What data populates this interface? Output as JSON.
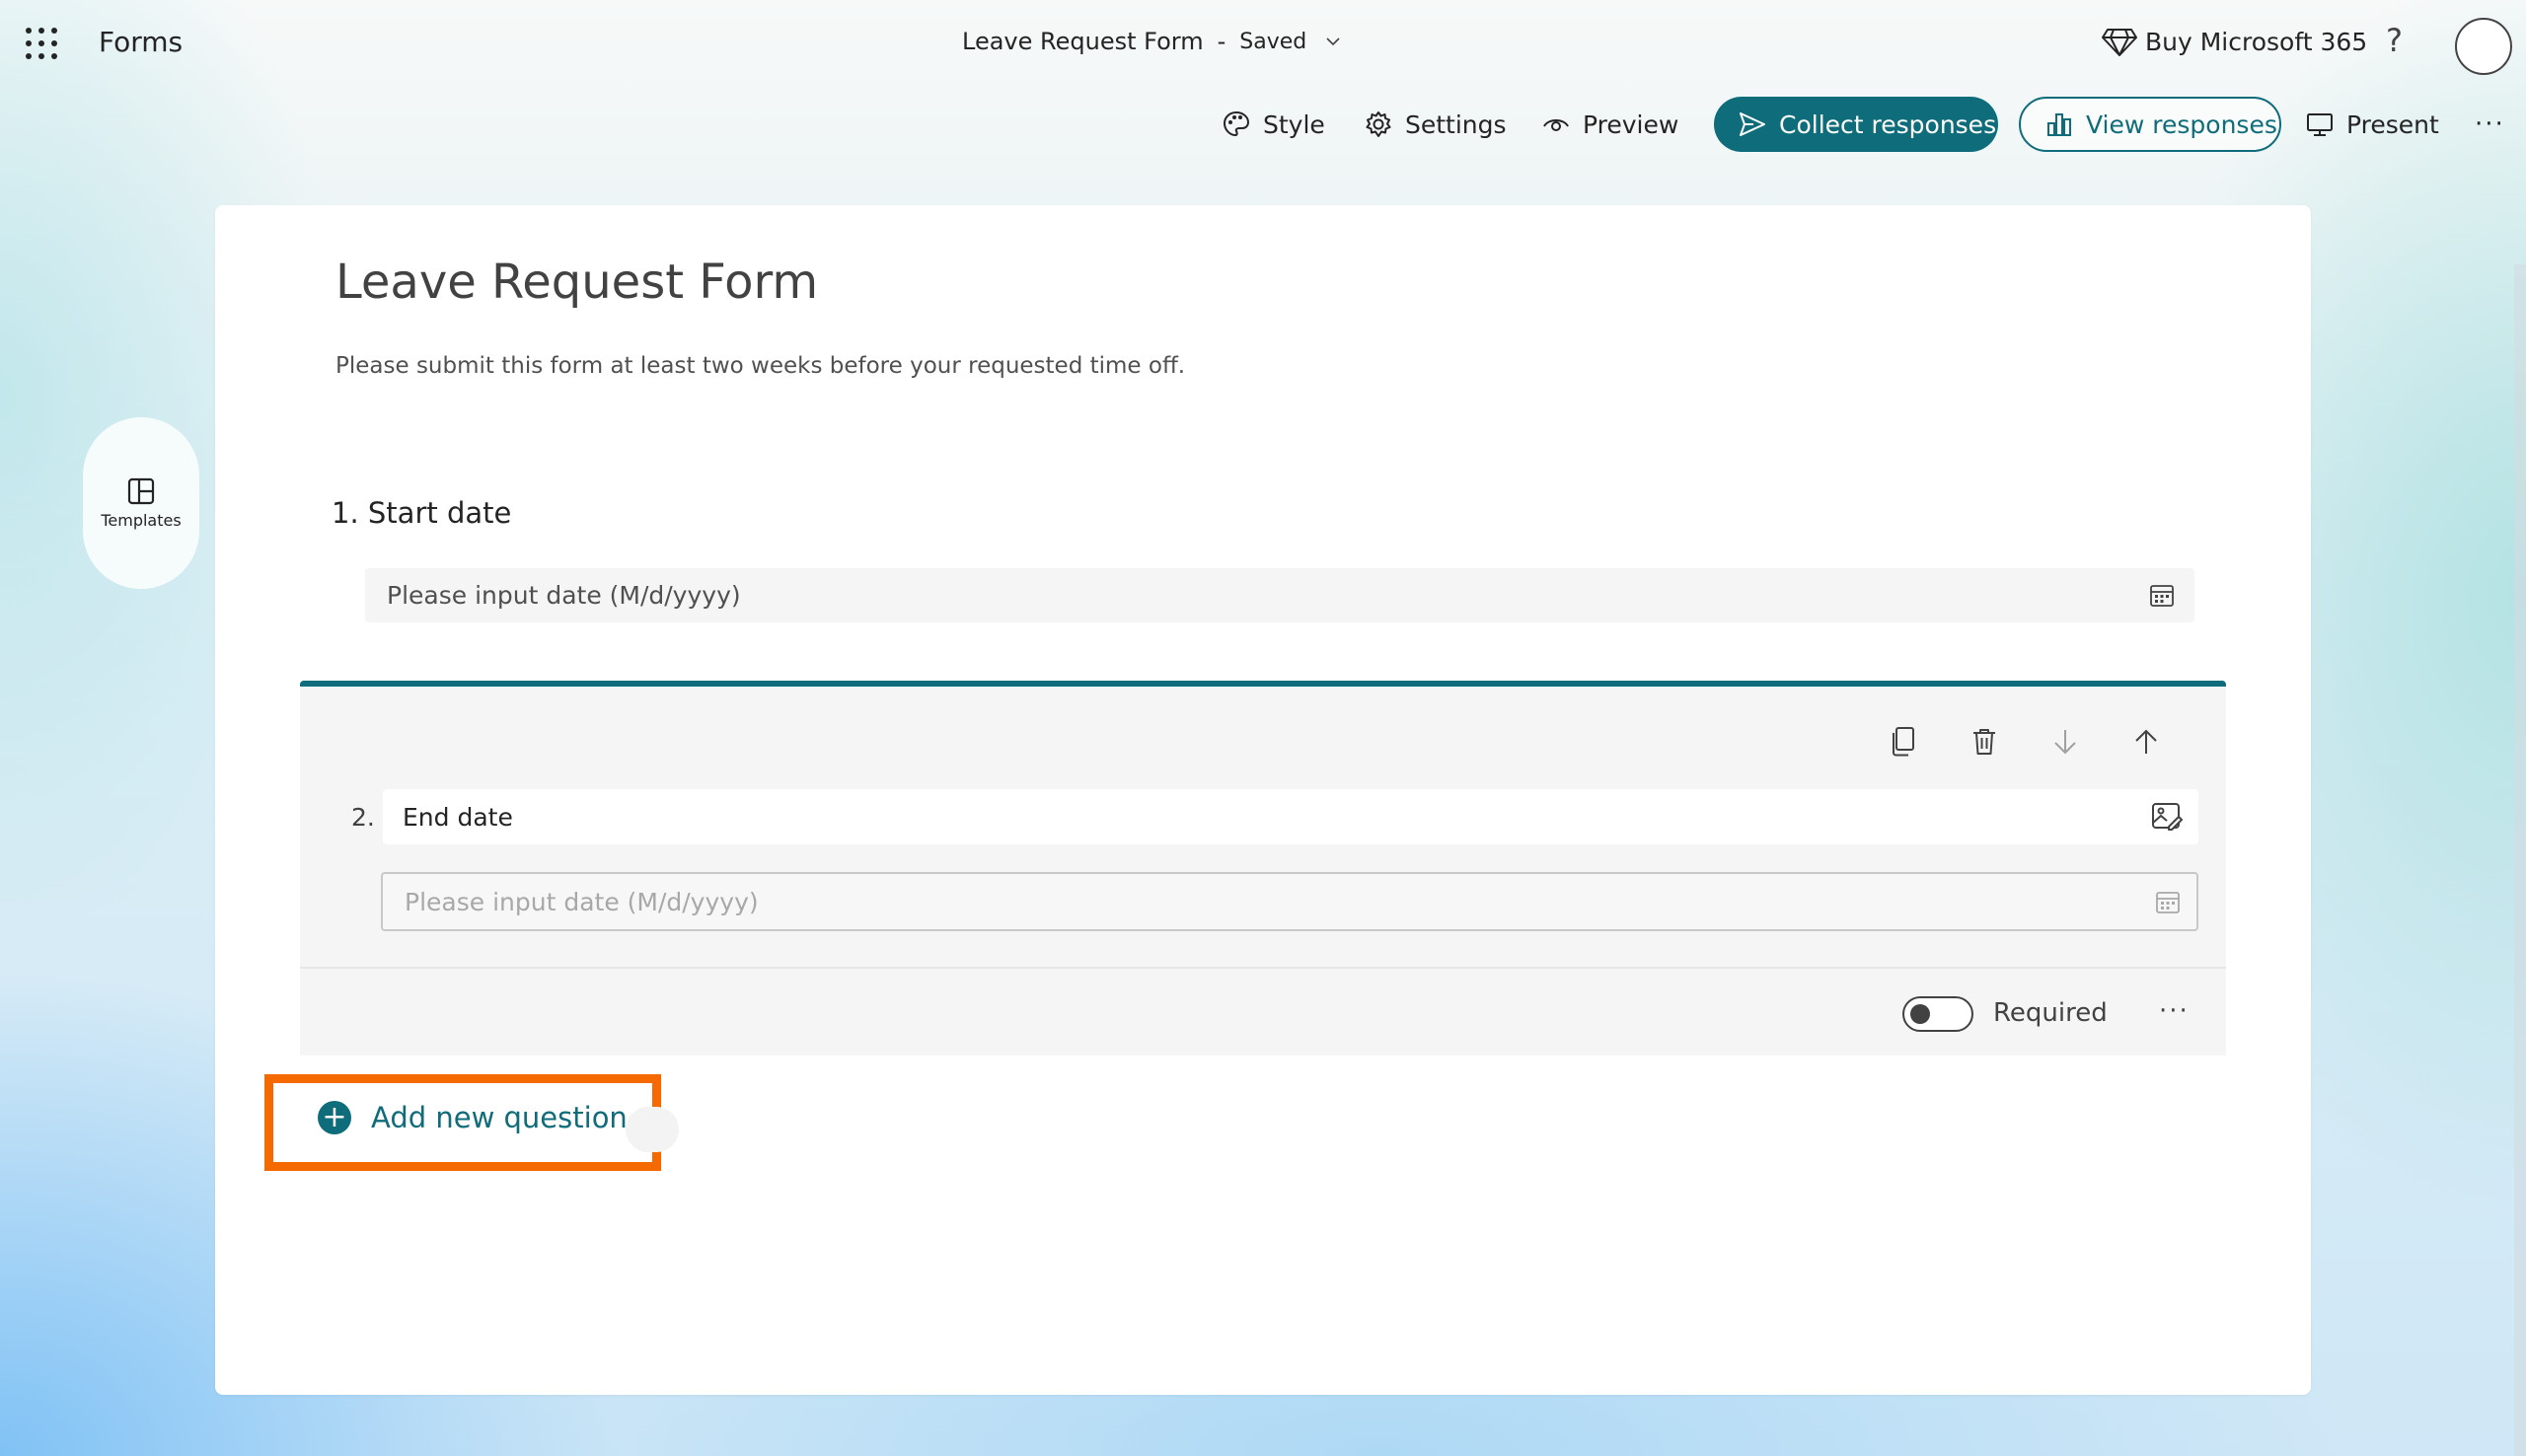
{
  "header": {
    "app_name": "Forms",
    "doc_title": "Leave Request Form",
    "separator": "-",
    "save_status": "Saved",
    "buy_label": "Buy Microsoft 365",
    "help_label": "?"
  },
  "toolbar": {
    "style": "Style",
    "settings": "Settings",
    "preview": "Preview",
    "collect": "Collect responses",
    "view": "View responses",
    "present": "Present",
    "more": "···"
  },
  "sidebar": {
    "templates_label": "Templates"
  },
  "form": {
    "title": "Leave Request Form",
    "description": "Please submit this form at least two weeks before your requested time off."
  },
  "questions": [
    {
      "number_label": "1.",
      "title": "Start date",
      "placeholder": "Please input date (M/d/yyyy)"
    },
    {
      "number_label": "2.",
      "title": "End date",
      "placeholder": "Please input date (M/d/yyyy)",
      "required_label": "Required",
      "required": false,
      "more": "···"
    }
  ],
  "add_question": {
    "label": "Add new question",
    "plus": "+"
  },
  "colors": {
    "accent": "#0f6c7b",
    "highlight": "#f56a00"
  }
}
